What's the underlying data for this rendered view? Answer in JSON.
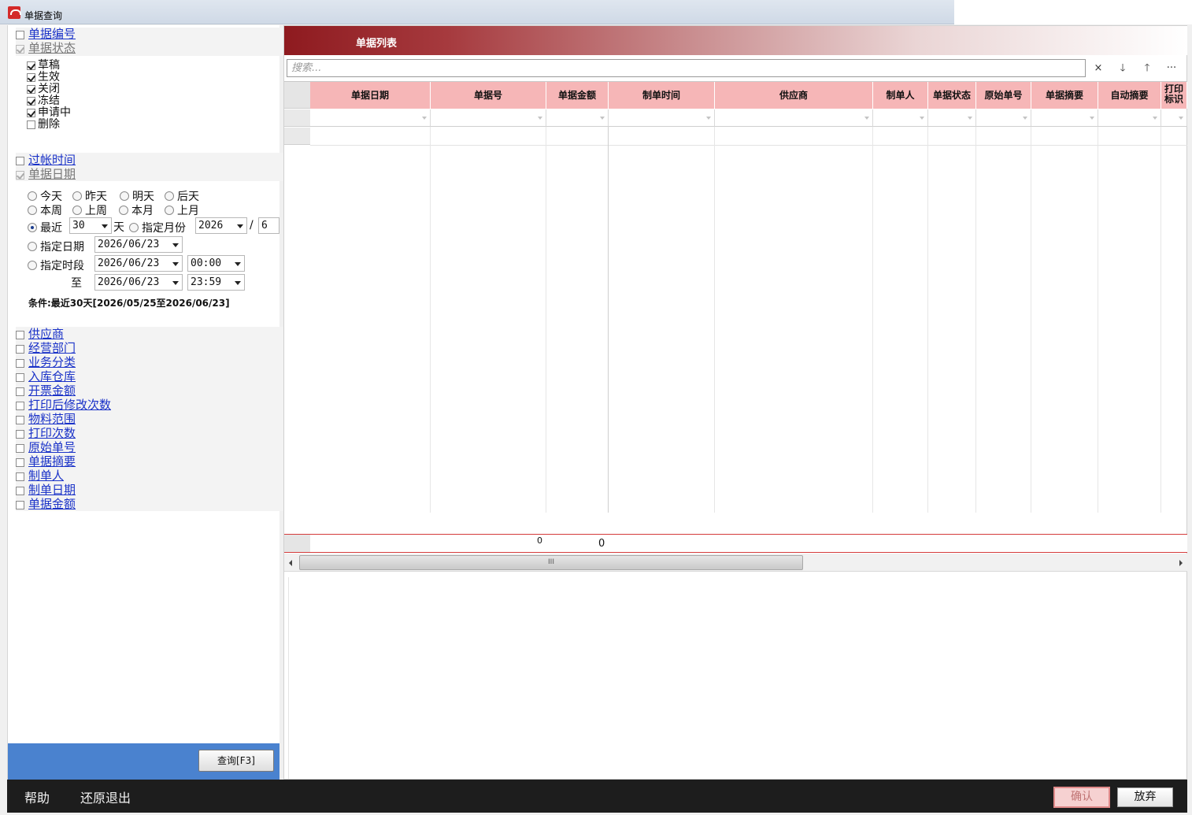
{
  "window": {
    "title": "单据查询"
  },
  "left": {
    "top_filters": [
      {
        "label": "单据编号",
        "checked": false,
        "enabled": true
      },
      {
        "label": "单据状态",
        "checked": true,
        "enabled": false
      }
    ],
    "status_items": [
      {
        "label": "草稿",
        "checked": true
      },
      {
        "label": "生效",
        "checked": true
      },
      {
        "label": "关闭",
        "checked": true
      },
      {
        "label": "冻结",
        "checked": true
      },
      {
        "label": "申请中",
        "checked": true
      },
      {
        "label": "删除",
        "checked": false
      }
    ],
    "date_filters": [
      {
        "label": "过帐时间",
        "checked": false,
        "enabled": true
      },
      {
        "label": "单据日期",
        "checked": true,
        "enabled": false
      }
    ],
    "radios_row1": [
      "今天",
      "昨天",
      "明天",
      "后天"
    ],
    "radios_row2": [
      "本周",
      "上周",
      "本月",
      "上月"
    ],
    "recent_label": "最近",
    "recent_days": "30",
    "day_unit": "天",
    "month_label": "指定月份",
    "month_year": "2026",
    "month_sep": "/",
    "month_month": "6",
    "date_label": "指定日期",
    "date_value": "2026/06/23",
    "period_label": "指定时段",
    "period_from_date": "2026/06/23",
    "period_from_time": "00:00",
    "to_label": "至",
    "period_to_date": "2026/06/23",
    "period_to_time": "23:59",
    "condition": "条件:最近30天[2026/05/25至2026/06/23]",
    "more_filters": [
      "供应商",
      "经营部门",
      "业务分类",
      "入库仓库",
      "开票金额",
      "打印后修改次数",
      "物料范围",
      "打印次数",
      "原始单号",
      "单据摘要",
      "制单人",
      "制单日期",
      "单据金额"
    ],
    "query_button": "查询[F3]"
  },
  "right": {
    "header_title": "单据列表",
    "search_placeholder": "搜索...",
    "search_buttons": [
      "×",
      "🡓",
      "🡑",
      "···"
    ],
    "columns": [
      "单据日期",
      "单据号",
      "单据金额",
      "制单时间",
      "供应商",
      "制单人",
      "单据状态",
      "原始单号",
      "单据摘要",
      "自动摘要",
      "打印标识"
    ],
    "footer_total_1": "0",
    "footer_total_2": "0",
    "scroll_grip": "III"
  },
  "bottom": {
    "help": "帮助",
    "restore_exit": "还原退出",
    "confirm": "确认",
    "cancel": "放弃"
  }
}
